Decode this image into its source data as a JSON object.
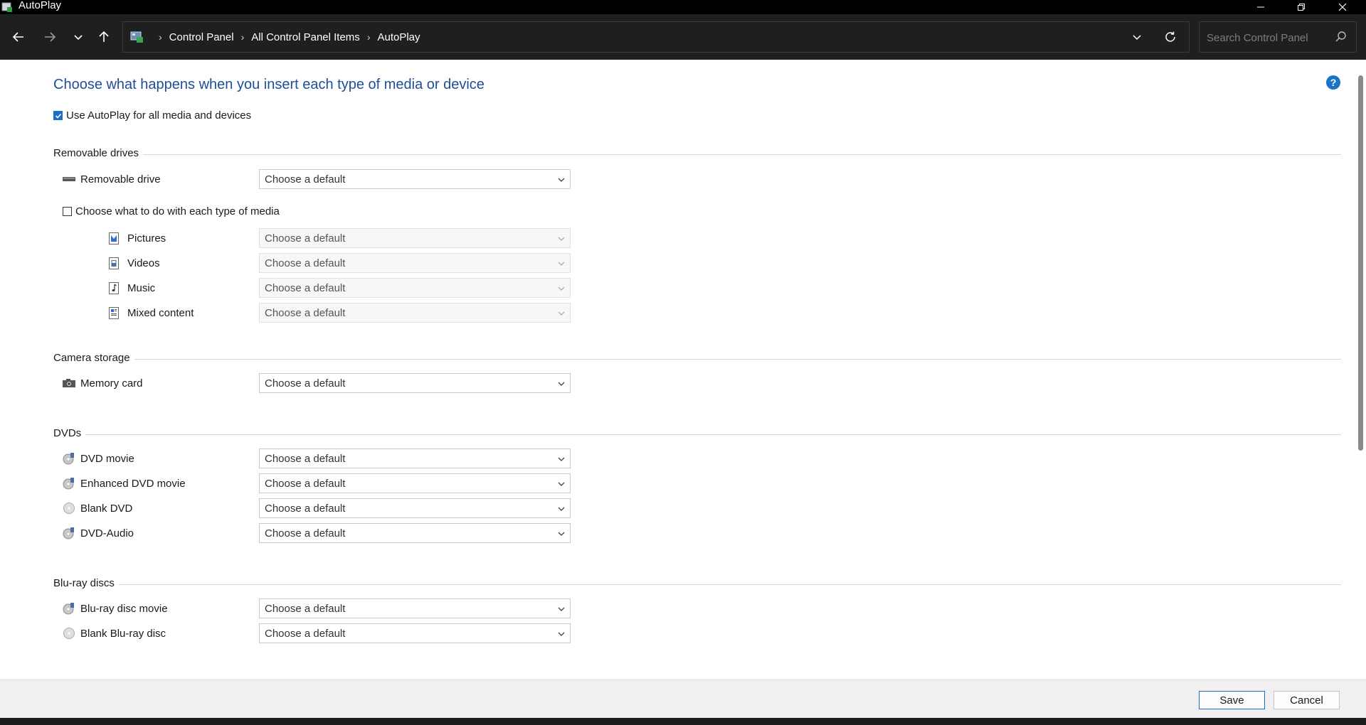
{
  "window": {
    "title": "AutoPlay"
  },
  "nav": {
    "breadcrumbs": [
      "Control Panel",
      "All Control Panel Items",
      "AutoPlay"
    ],
    "search_placeholder": "Search Control Panel"
  },
  "page": {
    "title": "Choose what happens when you insert each type of media or device",
    "use_autoplay_label": "Use AutoPlay for all media and devices",
    "use_autoplay_checked": true,
    "help_glyph": "?"
  },
  "sections": {
    "removable": {
      "header": "Removable drives",
      "removable_drive": {
        "label": "Removable drive",
        "value": "Choose a default"
      },
      "media_checkbox_label": "Choose what to do with each type of media",
      "media_checkbox_checked": false,
      "media": [
        {
          "label": "Pictures",
          "value": "Choose a default"
        },
        {
          "label": "Videos",
          "value": "Choose a default"
        },
        {
          "label": "Music",
          "value": "Choose a default"
        },
        {
          "label": "Mixed content",
          "value": "Choose a default"
        }
      ]
    },
    "camera": {
      "header": "Camera storage",
      "items": [
        {
          "label": "Memory card",
          "value": "Choose a default"
        }
      ]
    },
    "dvds": {
      "header": "DVDs",
      "items": [
        {
          "label": "DVD movie",
          "value": "Choose a default"
        },
        {
          "label": "Enhanced DVD movie",
          "value": "Choose a default"
        },
        {
          "label": "Blank DVD",
          "value": "Choose a default"
        },
        {
          "label": "DVD-Audio",
          "value": "Choose a default"
        }
      ]
    },
    "bluray": {
      "header": "Blu-ray discs",
      "items": [
        {
          "label": "Blu-ray disc movie",
          "value": "Choose a default"
        },
        {
          "label": "Blank Blu-ray disc",
          "value": "Choose a default"
        }
      ]
    }
  },
  "footer": {
    "save_label": "Save",
    "cancel_label": "Cancel"
  },
  "colors": {
    "accent": "#1a6fc9",
    "title_blue": "#1f4e99",
    "navbar": "#1f1f1f"
  }
}
